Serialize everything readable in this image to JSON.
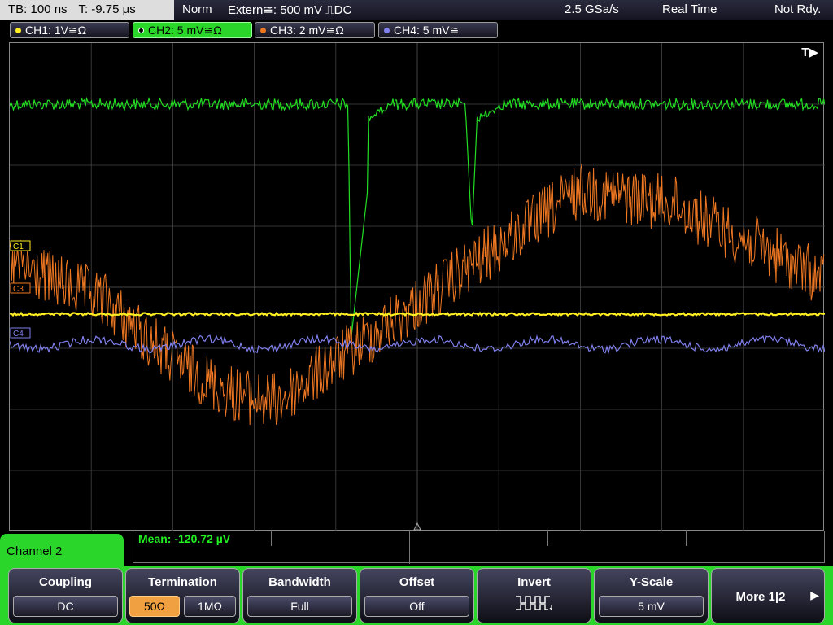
{
  "status": {
    "timebase": "TB: 100 ns",
    "trigger_time": "T: -9.75 µs",
    "mode": "Norm",
    "trigger_source": "Extern≅: 500 mV ⎍DC",
    "sample_rate": "2.5 GSa/s",
    "acq_mode": "Real Time",
    "ready_state": "Not Rdy."
  },
  "channels": [
    {
      "label": "CH1: 1V≅Ω",
      "color": "#ffee22",
      "active": false
    },
    {
      "label": "CH2: 5 mV≅Ω",
      "color": "#22dd22",
      "active": true
    },
    {
      "label": "CH3: 2 mV≅Ω",
      "color": "#ee7722",
      "active": false
    },
    {
      "label": "CH4: 5 mV≅",
      "color": "#8080ee",
      "active": false
    }
  ],
  "markers": {
    "trigger_flag": "T▶",
    "c1": "C1",
    "c3": "C3",
    "c4": "C4"
  },
  "measurement": {
    "mean": "Mean: -120.72 µV"
  },
  "menu": {
    "title": "Channel 2",
    "coupling": {
      "label": "Coupling",
      "value": "DC"
    },
    "termination": {
      "label": "Termination",
      "options": [
        "50Ω",
        "1MΩ"
      ],
      "selected": "50Ω"
    },
    "bandwidth": {
      "label": "Bandwidth",
      "value": "Full"
    },
    "offset": {
      "label": "Offset",
      "value": "Off"
    },
    "invert": {
      "label": "Invert",
      "icon": "inverted-square-wave-icon"
    },
    "yscale": {
      "label": "Y-Scale",
      "value": "5 mV"
    },
    "more": {
      "label": "More 1|2",
      "icon": "right-arrow-icon"
    }
  },
  "colors": {
    "ch1": "#ffee22",
    "ch2": "#22dd22",
    "ch3": "#ee7722",
    "ch4": "#8080ee",
    "menu_accent": "#2bd62b",
    "selected_option": "#f0a040"
  }
}
